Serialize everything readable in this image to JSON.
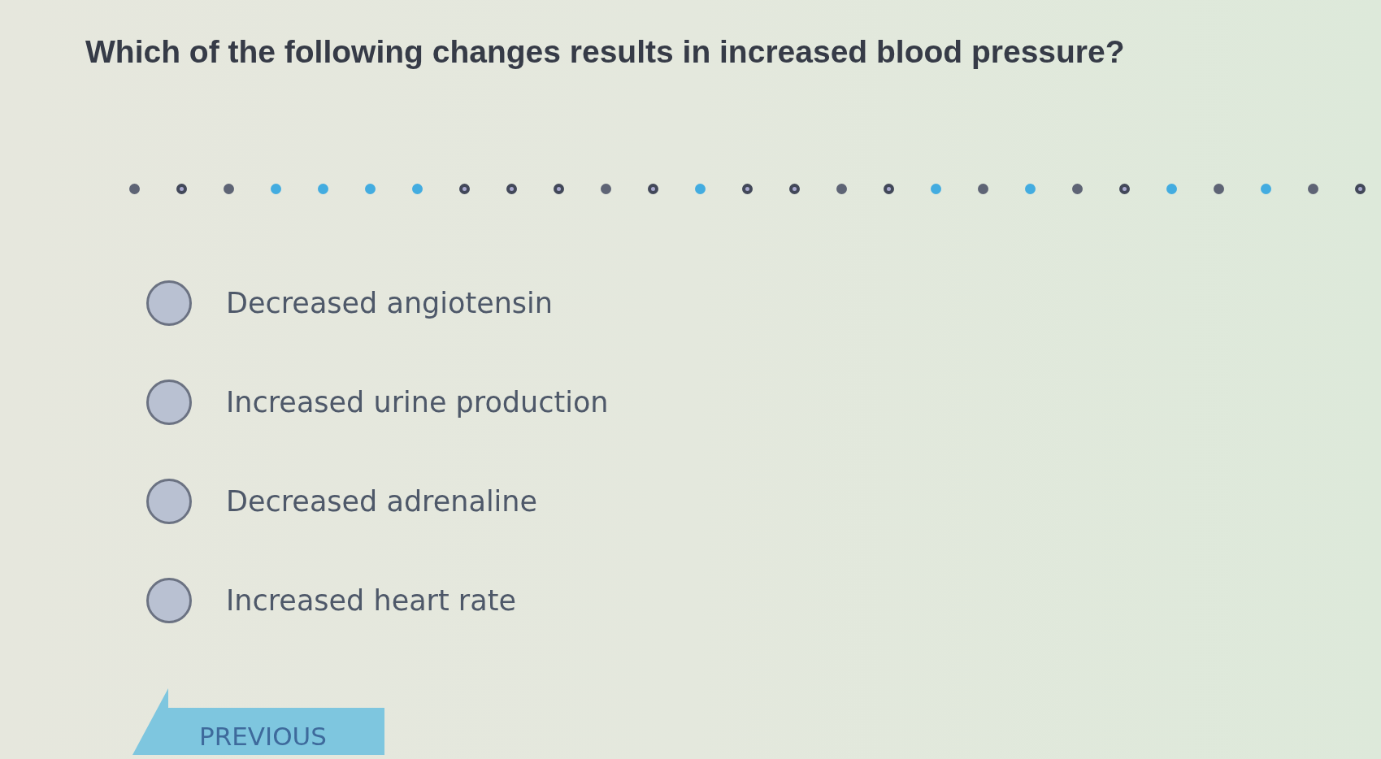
{
  "question": {
    "text": "Which of the following changes results in increased blood pressure?"
  },
  "progress_dots": [
    {
      "kind": "filled",
      "color": "#5e6475"
    },
    {
      "kind": "ring",
      "color": "#424859"
    },
    {
      "kind": "filled",
      "color": "#5e6475"
    },
    {
      "kind": "filled",
      "color": "#43ace0"
    },
    {
      "kind": "filled",
      "color": "#43ace0"
    },
    {
      "kind": "filled",
      "color": "#43ace0"
    },
    {
      "kind": "filled",
      "color": "#43ace0"
    },
    {
      "kind": "ring",
      "color": "#424859"
    },
    {
      "kind": "ring",
      "color": "#424859"
    },
    {
      "kind": "ring",
      "color": "#424859"
    },
    {
      "kind": "filled",
      "color": "#5e6475"
    },
    {
      "kind": "ring",
      "color": "#424859"
    },
    {
      "kind": "filled",
      "color": "#43ace0"
    },
    {
      "kind": "ring",
      "color": "#424859"
    },
    {
      "kind": "ring",
      "color": "#424859"
    },
    {
      "kind": "filled",
      "color": "#5e6475"
    },
    {
      "kind": "ring",
      "color": "#424859"
    },
    {
      "kind": "filled",
      "color": "#43ace0"
    },
    {
      "kind": "filled",
      "color": "#5e6475"
    },
    {
      "kind": "filled",
      "color": "#43ace0"
    },
    {
      "kind": "filled",
      "color": "#5e6475"
    },
    {
      "kind": "ring",
      "color": "#424859"
    },
    {
      "kind": "filled",
      "color": "#43ace0"
    },
    {
      "kind": "filled",
      "color": "#5e6475"
    },
    {
      "kind": "filled",
      "color": "#43ace0"
    },
    {
      "kind": "filled",
      "color": "#5e6475"
    },
    {
      "kind": "ring",
      "color": "#424859"
    }
  ],
  "options": [
    {
      "label": "Decreased angiotensin",
      "selected": false
    },
    {
      "label": "Increased urine production",
      "selected": false
    },
    {
      "label": "Decreased adrenaline",
      "selected": false
    },
    {
      "label": "Increased heart rate",
      "selected": false
    }
  ],
  "navigation": {
    "previous_button": "PREVIOUS"
  }
}
